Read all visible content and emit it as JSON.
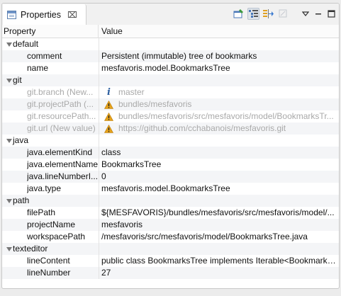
{
  "tab": {
    "label": "Properties",
    "close": "⌧"
  },
  "header": {
    "property": "Property",
    "value": "Value"
  },
  "rows": [
    {
      "kind": "category",
      "label": "default"
    },
    {
      "kind": "child",
      "label": "comment",
      "value": "Persistent (immutable) tree of bookmarks"
    },
    {
      "kind": "child",
      "label": "name",
      "value": "mesfavoris.model.BookmarksTree"
    },
    {
      "kind": "category",
      "label": "git"
    },
    {
      "kind": "child",
      "disabled": true,
      "label": "git.branch (New...",
      "icon": "info-icon",
      "value": "master"
    },
    {
      "kind": "child",
      "disabled": true,
      "label": "git.projectPath (...",
      "icon": "warning-icon",
      "value": "bundles/mesfavoris"
    },
    {
      "kind": "child",
      "disabled": true,
      "label": "git.resourcePath...",
      "icon": "warning-icon",
      "value": "bundles/mesfavoris/src/mesfavoris/model/BookmarksTr..."
    },
    {
      "kind": "child",
      "disabled": true,
      "label": "git.url (New value)",
      "icon": "warning-icon",
      "value": "https://github.com/cchabanois/mesfavoris.git"
    },
    {
      "kind": "category",
      "label": "java"
    },
    {
      "kind": "child",
      "label": "java.elementKind",
      "value": "class"
    },
    {
      "kind": "child",
      "label": "java.elementName",
      "value": "BookmarksTree"
    },
    {
      "kind": "child",
      "label": "java.lineNumberI...",
      "value": "0"
    },
    {
      "kind": "child",
      "label": "java.type",
      "value": "mesfavoris.model.BookmarksTree"
    },
    {
      "kind": "category",
      "label": "path"
    },
    {
      "kind": "child",
      "label": "filePath",
      "value": "${MESFAVORIS}/bundles/mesfavoris/src/mesfavoris/model/..."
    },
    {
      "kind": "child",
      "label": "projectName",
      "value": "mesfavoris"
    },
    {
      "kind": "child",
      "label": "workspacePath",
      "value": "/mesfavoris/src/mesfavoris/model/BookmarksTree.java"
    },
    {
      "kind": "category",
      "label": "texteditor"
    },
    {
      "kind": "child",
      "label": "lineContent",
      "value": "public class BookmarksTree implements Iterable<Bookmark> {"
    },
    {
      "kind": "child",
      "label": "lineNumber",
      "value": "27"
    }
  ],
  "colors": {
    "accent": "#2d5fa0",
    "warning": "#e5a21b",
    "disabled_text": "#a9a9a9",
    "alt_row": "#f4f5f7"
  }
}
